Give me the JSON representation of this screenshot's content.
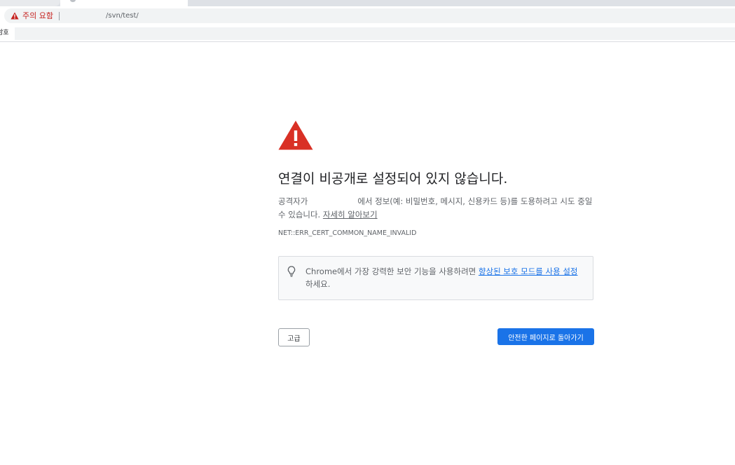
{
  "browser": {
    "security_chip_label": "주의 요함",
    "url_path": "/svn/test/",
    "bookmark_label": "암호"
  },
  "interstitial": {
    "headline": "연결이 비공개로 설정되어 있지 않습니다.",
    "body_lead": "공격자가",
    "body_rest": "에서 정보(예: 비밀번호, 메시지, 신용카드 등)를 도용하려고 시도 중일 수 있습니다.",
    "learn_more_link": "자세히 알아보기",
    "error_code": "NET::ERR_CERT_COMMON_NAME_INVALID",
    "callout_pre": "Chrome에서 가장 강력한 보안 기능을 사용하려면",
    "callout_link": "향상된 보호 모드를 사용 설정",
    "callout_post": "하세요.",
    "advanced_button": "고급",
    "back_button": "안전한 페이지로 돌아가기"
  },
  "colors": {
    "warning_red": "#d93025",
    "primary_blue": "#1a73e8"
  },
  "icons": {
    "security_chip": "warning-triangle-icon",
    "main": "warning-triangle-icon",
    "callout": "lightbulb-icon"
  }
}
